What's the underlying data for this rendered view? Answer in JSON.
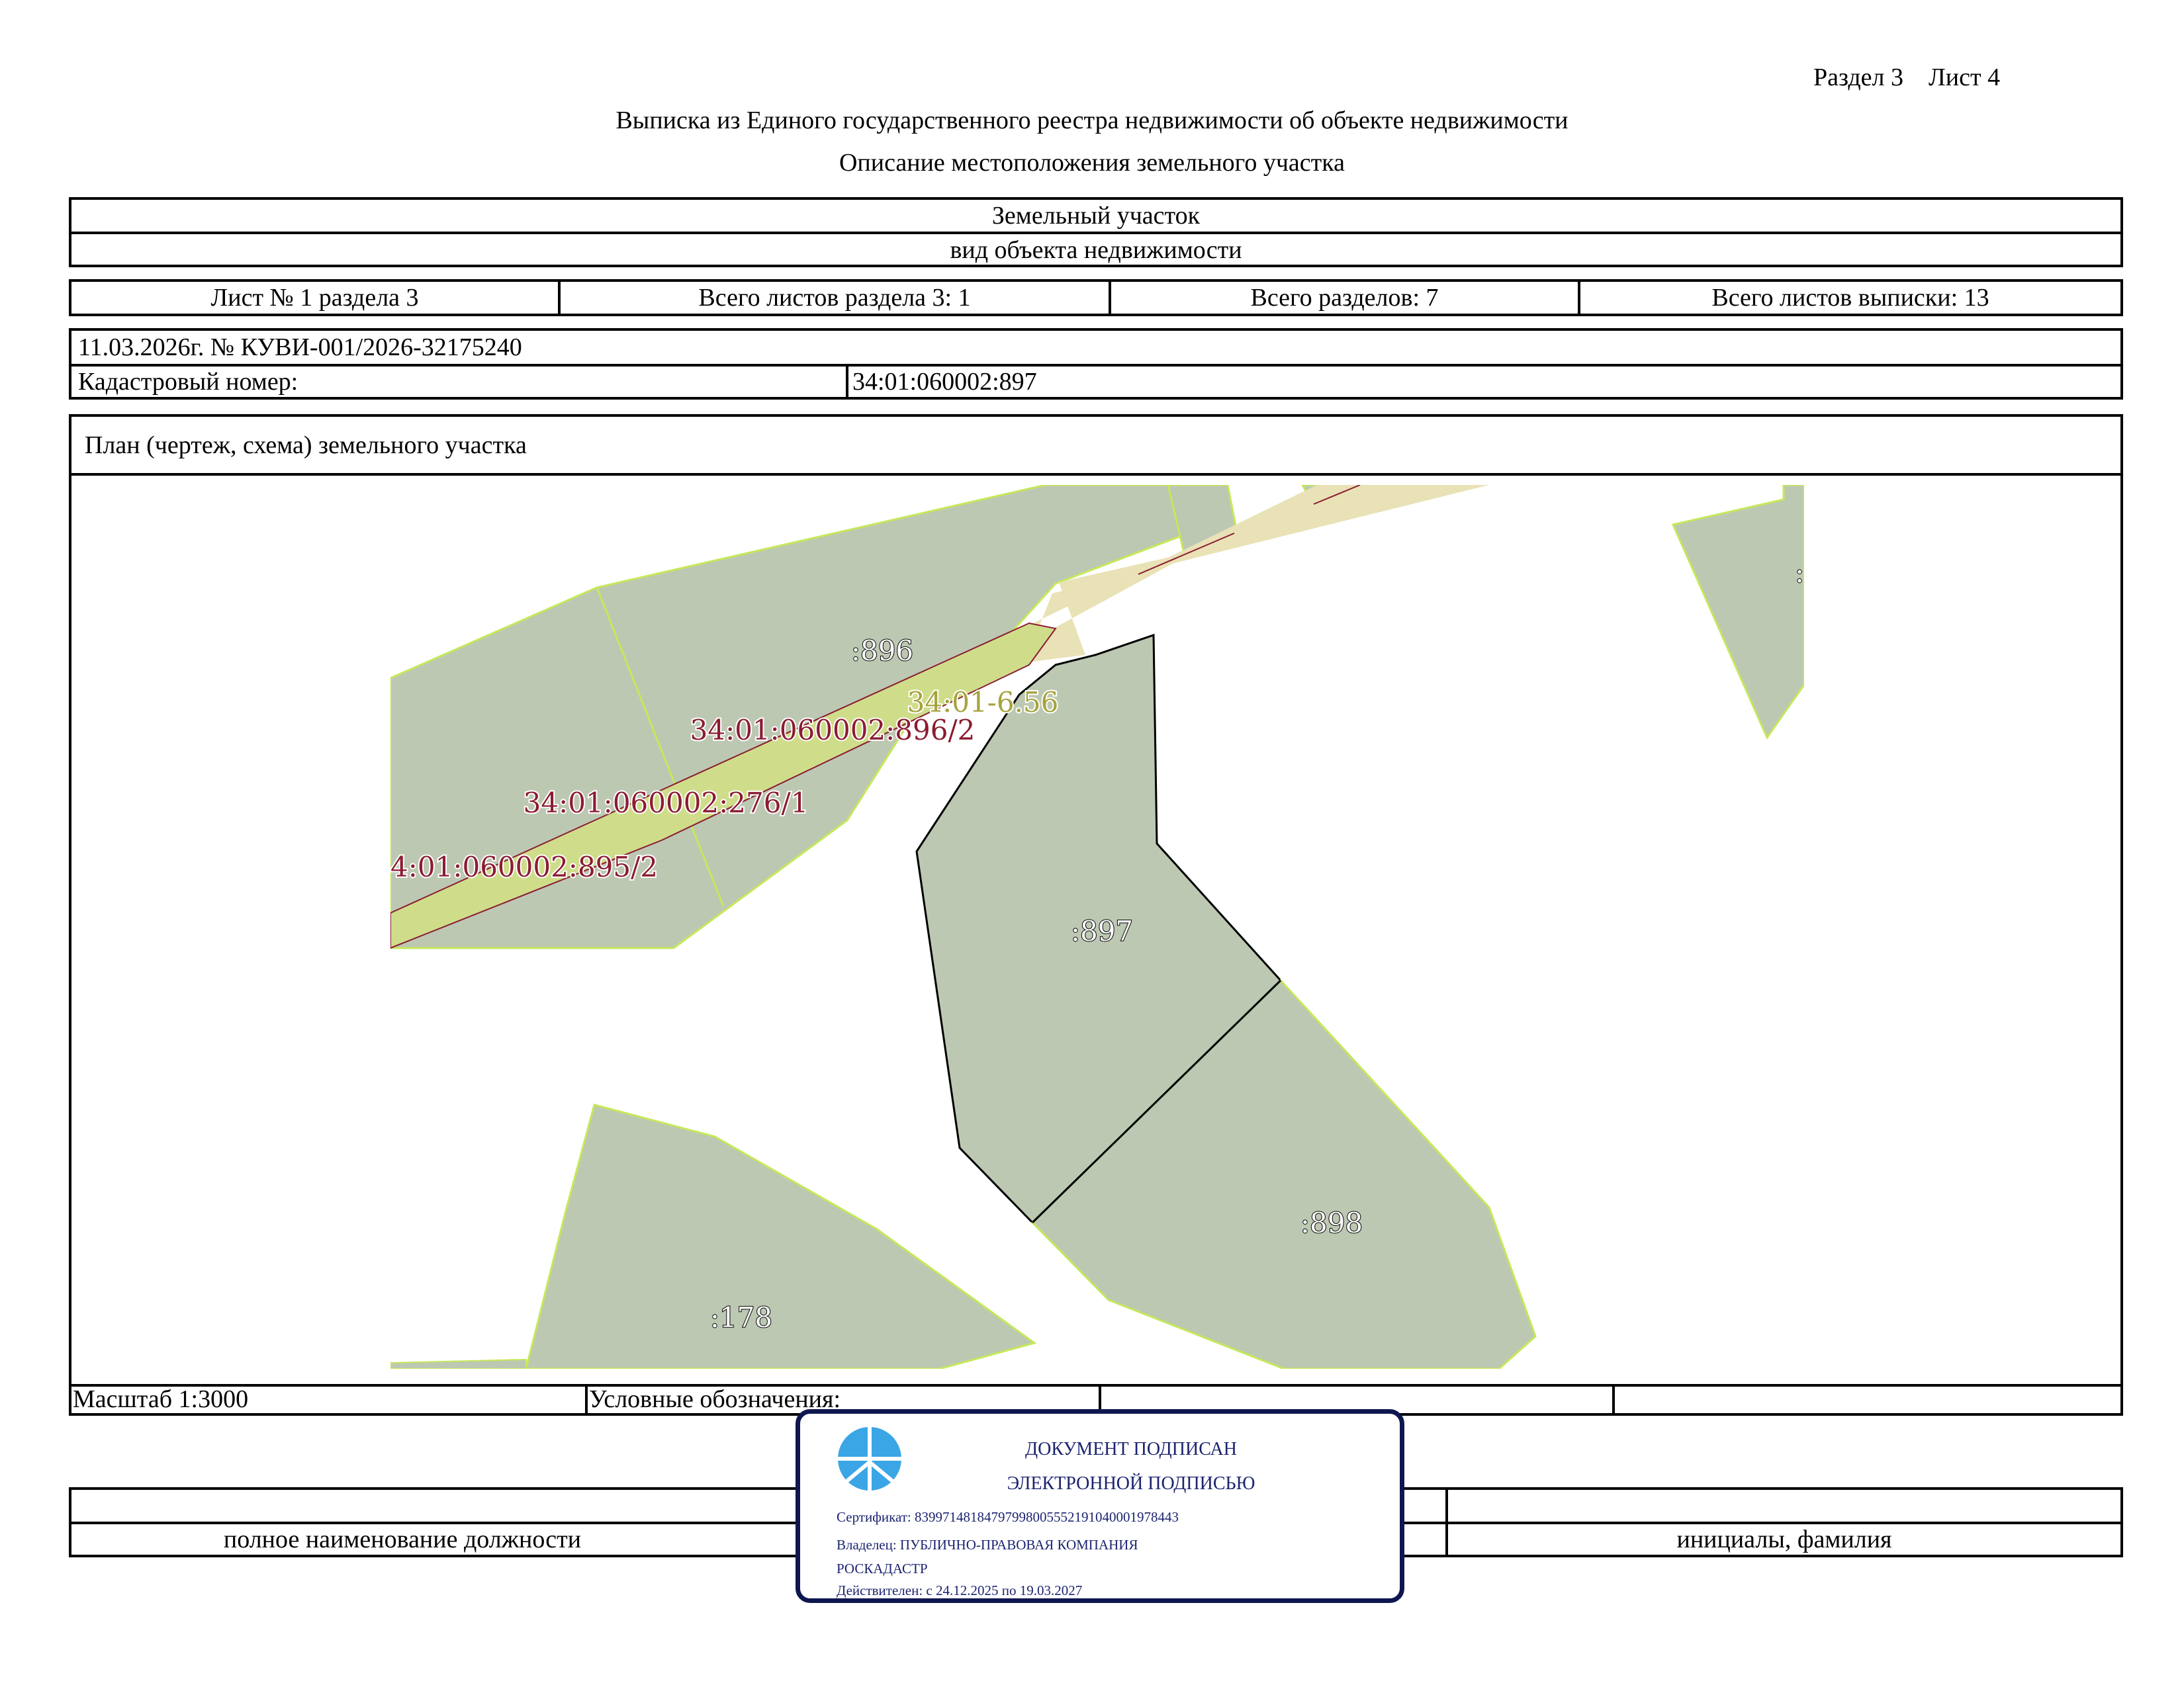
{
  "header": {
    "section_sheet": "Раздел 3    Лист 4",
    "title": "Выписка из Единого государственного реестра недвижимости об объекте недвижимости",
    "subtitle": "Описание местоположения земельного участка"
  },
  "object": {
    "kind": "Земельный участок",
    "kind_caption": "вид объекта недвижимости"
  },
  "sheet_info": {
    "sheet": "Лист № 1 раздела 3",
    "total_sheets_section": "Всего листов раздела 3: 1",
    "total_sections": "Всего разделов: 7",
    "total_sheets": "Всего листов выписки: 13"
  },
  "record": {
    "date_number": "11.03.2026г. № КУВИ-001/2026-32175240",
    "cadastral_label": "Кадастровый номер:",
    "cadastral_value": "34:01:060002:897"
  },
  "plan": {
    "title": "План (чертеж, схема) земельного участка",
    "labels": {
      "p896": ":896",
      "road": "34:01-6.56",
      "zone_896_2": "34:01:060002:896/2",
      "zone_276_1": "34:01:060002:276/1",
      "zone_895_2": "4:01:060002:895/2",
      "p897": ":897",
      "p898": ":898",
      "p178": ":178",
      "partial": ":"
    },
    "colors": {
      "parcel_fill": "#bdc8b3",
      "parcel_stroke": "#c6e85a",
      "road_fill": "#e9e2b6",
      "zone_fill": "#cfdd8a",
      "zone_label": "#8b1c32",
      "road_label": "#a5a33d",
      "target_stroke": "#000000"
    }
  },
  "footer": {
    "scale": "Масштаб 1:3000",
    "legend_label": "Условные обозначения:"
  },
  "signature": {
    "position_caption": "полное наименование должности",
    "name_caption": "инициалы, фамилия"
  },
  "stamp": {
    "line1": "ДОКУМЕНТ ПОДПИСАН",
    "line2": "ЭЛЕКТРОННОЙ ПОДПИСЬЮ",
    "certificate": "Сертификат: 83997148184797998005552191040001978443",
    "owner_line1": "Владелец: ПУБЛИЧНО-ПРАВОВАЯ КОМПАНИЯ",
    "owner_line2": "РОСКАДАСТР",
    "valid": "Действителен: с 24.12.2025 по 19.03.2027",
    "logo_icon": "roskadastr-logo-icon",
    "border_color": "#0f1750",
    "text_color": "#1b2470"
  }
}
